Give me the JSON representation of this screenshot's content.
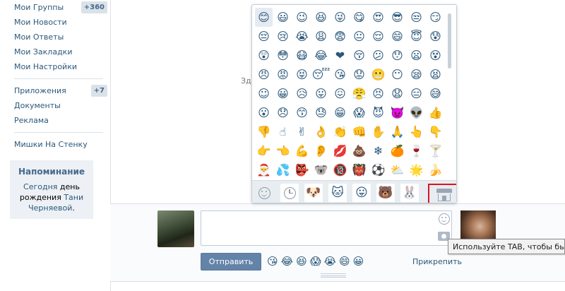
{
  "sidebar": {
    "items": [
      {
        "label": "Мои Группы",
        "count": "+360"
      },
      {
        "label": "Мои Новости"
      },
      {
        "label": "Мои Ответы"
      },
      {
        "label": "Мои Закладки"
      },
      {
        "label": "Мои Настройки"
      }
    ],
    "items2": [
      {
        "label": "Приложения",
        "count": "+7"
      },
      {
        "label": "Документы"
      },
      {
        "label": "Реклама"
      }
    ],
    "items3": [
      {
        "label": "Мишки На Стенку"
      }
    ],
    "reminder": {
      "title": "Напоминание",
      "today": "Сегодня",
      "text1": "день",
      "text2": "рождения",
      "name1": "Тани",
      "name2": "Черняевой",
      "suffix": "."
    }
  },
  "wall": {
    "partial_text": "Зд"
  },
  "emoji_picker": {
    "emojis": [
      "😊",
      "😃",
      "😉",
      "😆",
      "😜",
      "😋",
      "😍",
      "😎",
      "😒",
      "😏",
      "😔",
      "😢",
      "😭",
      "😩",
      "😨",
      "😐",
      "😌",
      "😄",
      "😇",
      "😰",
      "😲",
      "😳",
      "😷",
      "😂",
      "❤",
      "😚",
      "😕",
      "😯",
      "😦",
      "😵",
      "😠",
      "😡",
      "😝",
      "😴",
      "😘",
      "😟",
      "😬",
      "😶",
      "😪",
      "😫",
      "☺",
      "😀",
      "😥",
      "😛",
      "😖",
      "😤",
      "😣",
      "😧",
      "😑",
      "😅",
      "😮",
      "😞",
      "😙",
      "😓",
      "😁",
      "😱",
      "😈",
      "👿",
      "👽",
      "👍",
      "👎",
      "☝",
      "✌",
      "👌",
      "👏",
      "👊",
      "✋",
      "🙏",
      "👆",
      "👇",
      "👉",
      "👈",
      "💪",
      "👂",
      "💋",
      "💩",
      "❄",
      "🍊",
      "🍷",
      "🍸",
      "🎅",
      "💦",
      "👺",
      "🐨",
      "🔞",
      "👹",
      "⚽",
      "⛅",
      "🌟",
      "🍌"
    ],
    "tabs": [
      "smile-icon",
      "clock-icon",
      "🐶",
      "🐱",
      "😛",
      "🐻",
      "🐰",
      "store-icon"
    ]
  },
  "composer": {
    "send_label": "Отправить",
    "quick_emojis": [
      "😘",
      "😂",
      "😆",
      "😱",
      "😭",
      "😄",
      "😀"
    ],
    "attach_label": "Прикрепить",
    "tooltip": "Используйте TAB, чтобы быс"
  },
  "colors": {
    "link": "#2b587a",
    "accent_button": "#6383a8",
    "highlight_box": "#d9161e",
    "counter_bg": "#dae2e8"
  }
}
